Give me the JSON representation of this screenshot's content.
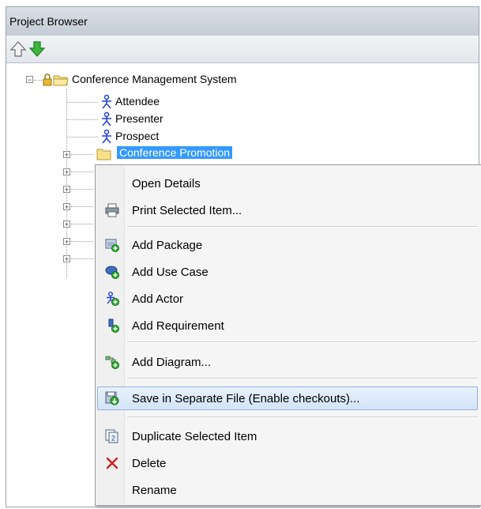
{
  "window": {
    "title": "Project Browser"
  },
  "toolbar": {
    "up_icon": "up-arrow-icon",
    "down_icon": "down-arrow-icon"
  },
  "tree": {
    "root": {
      "label": "Conference Management System"
    },
    "actors": [
      {
        "label": "Attendee"
      },
      {
        "label": "Presenter"
      },
      {
        "label": "Prospect"
      }
    ],
    "selected_package": {
      "label": "Conference Promotion"
    }
  },
  "context_menu": {
    "items": [
      {
        "label": "Open Details"
      },
      {
        "label": "Print Selected Item..."
      },
      {
        "label": "Add Package"
      },
      {
        "label": "Add Use Case"
      },
      {
        "label": "Add Actor"
      },
      {
        "label": "Add Requirement"
      },
      {
        "label": "Add Diagram..."
      },
      {
        "label": "Save in Separate File (Enable checkouts)..."
      },
      {
        "label": "Duplicate Selected Item"
      },
      {
        "label": "Delete"
      },
      {
        "label": "Rename"
      }
    ]
  },
  "colors": {
    "selection": "#3399ff",
    "actor": "#1f3fd6",
    "hover_border": "#8fb3dc"
  }
}
